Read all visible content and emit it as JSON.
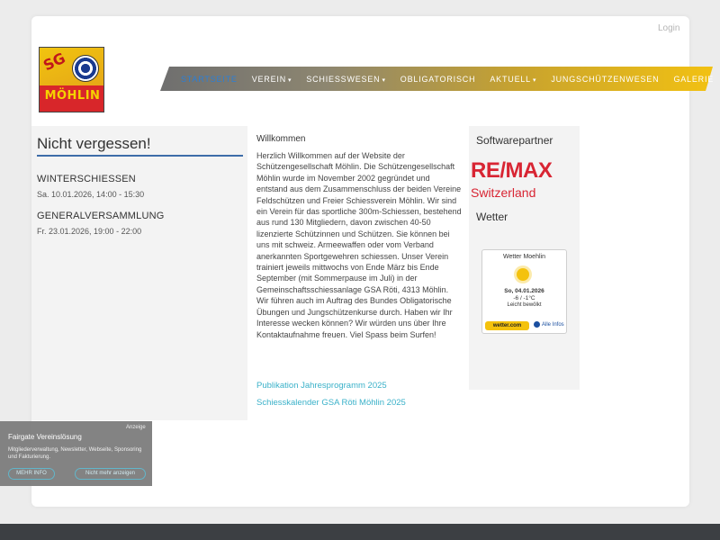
{
  "header": {
    "login_label": "Login",
    "logo": {
      "top_text": "SG",
      "bottom_text": "MÖHLIN"
    },
    "nav": [
      {
        "label": "STARTSEITE",
        "active": true,
        "has_dropdown": false
      },
      {
        "label": "VEREIN",
        "active": false,
        "has_dropdown": true
      },
      {
        "label": "SCHIESSWESEN",
        "active": false,
        "has_dropdown": true
      },
      {
        "label": "OBLIGATORISCH",
        "active": false,
        "has_dropdown": false
      },
      {
        "label": "AKTUELL",
        "active": false,
        "has_dropdown": true
      },
      {
        "label": "JUNGSCHÜTZENWESEN",
        "active": false,
        "has_dropdown": false
      },
      {
        "label": "GALERIE",
        "active": false,
        "has_dropdown": false
      }
    ]
  },
  "left": {
    "title": "Nicht vergessen!",
    "events": [
      {
        "title": "WINTERSCHIESSEN",
        "date": "Sa. 10.01.2026, 14:00 - 15:30"
      },
      {
        "title": "GENERALVERSAMMLUNG",
        "date": "Fr. 23.01.2026, 19:00 - 22:00"
      }
    ]
  },
  "main": {
    "title": "Willkommen",
    "body": "Herzlich Willkommen auf der Website der Schützengesellschaft Möhlin. Die Schützengesellschaft Möhlin wurde im November 2002 gegründet und entstand aus dem Zusammenschluss der beiden Vereine Feldschützen und Freier Schiessverein Möhlin. Wir sind ein Verein für das sportliche 300m-Schiessen, bestehend aus rund 130 Mitgliedern, davon zwischen 40-50 lizenzierte Schützinnen und Schützen. Sie können bei uns mit schweiz. Armeewaffen oder vom Verband anerkannten Sportgewehren schiessen. Unser Verein trainiert jeweils mittwochs von Ende März bis Ende September (mit Sommerpause im Juli) in der Gemeinschaftsschiessanlage GSA Röti, 4313 Möhlin. Wir führen auch im Auftrag des Bundes Obligatorische Übungen und Jungschützenkurse durch. Haben wir Ihr Interesse wecken können? Wir würden uns über Ihre Kontaktaufnahme freuen. Viel Spass beim Surfen!",
    "links": [
      "Publikation Jahresprogramm 2025",
      "Schiesskalender GSA Röti Möhlin 2025"
    ]
  },
  "right": {
    "partner_heading": "Softwarepartner",
    "partner_logo": {
      "name": "RE/MAX",
      "country": "Switzerland",
      "color": "#d82533"
    },
    "weather_heading": "Wetter",
    "weather": {
      "title": "Wetter Moehlin",
      "date": "So, 04.01.2026",
      "temp": "-6 / -1°C",
      "condition": "Leicht bewölkt",
      "brand": "wetter.com",
      "more": "Alle Infos",
      "icon": "partly-sunny-icon"
    }
  },
  "ad": {
    "label": "Anzeige",
    "title": "Fairgate Vereinslösung",
    "text": "Mitgliederverwaltung, Newsletter, Webseite, Sponsoring und Fakturierung.",
    "button_more": "MEHR INFO",
    "button_hide": "Nicht mehr anzeigen"
  },
  "colors": {
    "accent": "#2b7fd6",
    "link": "#3ab1c9",
    "rule": "#3d6ca8",
    "footer": "#3c3f43"
  }
}
